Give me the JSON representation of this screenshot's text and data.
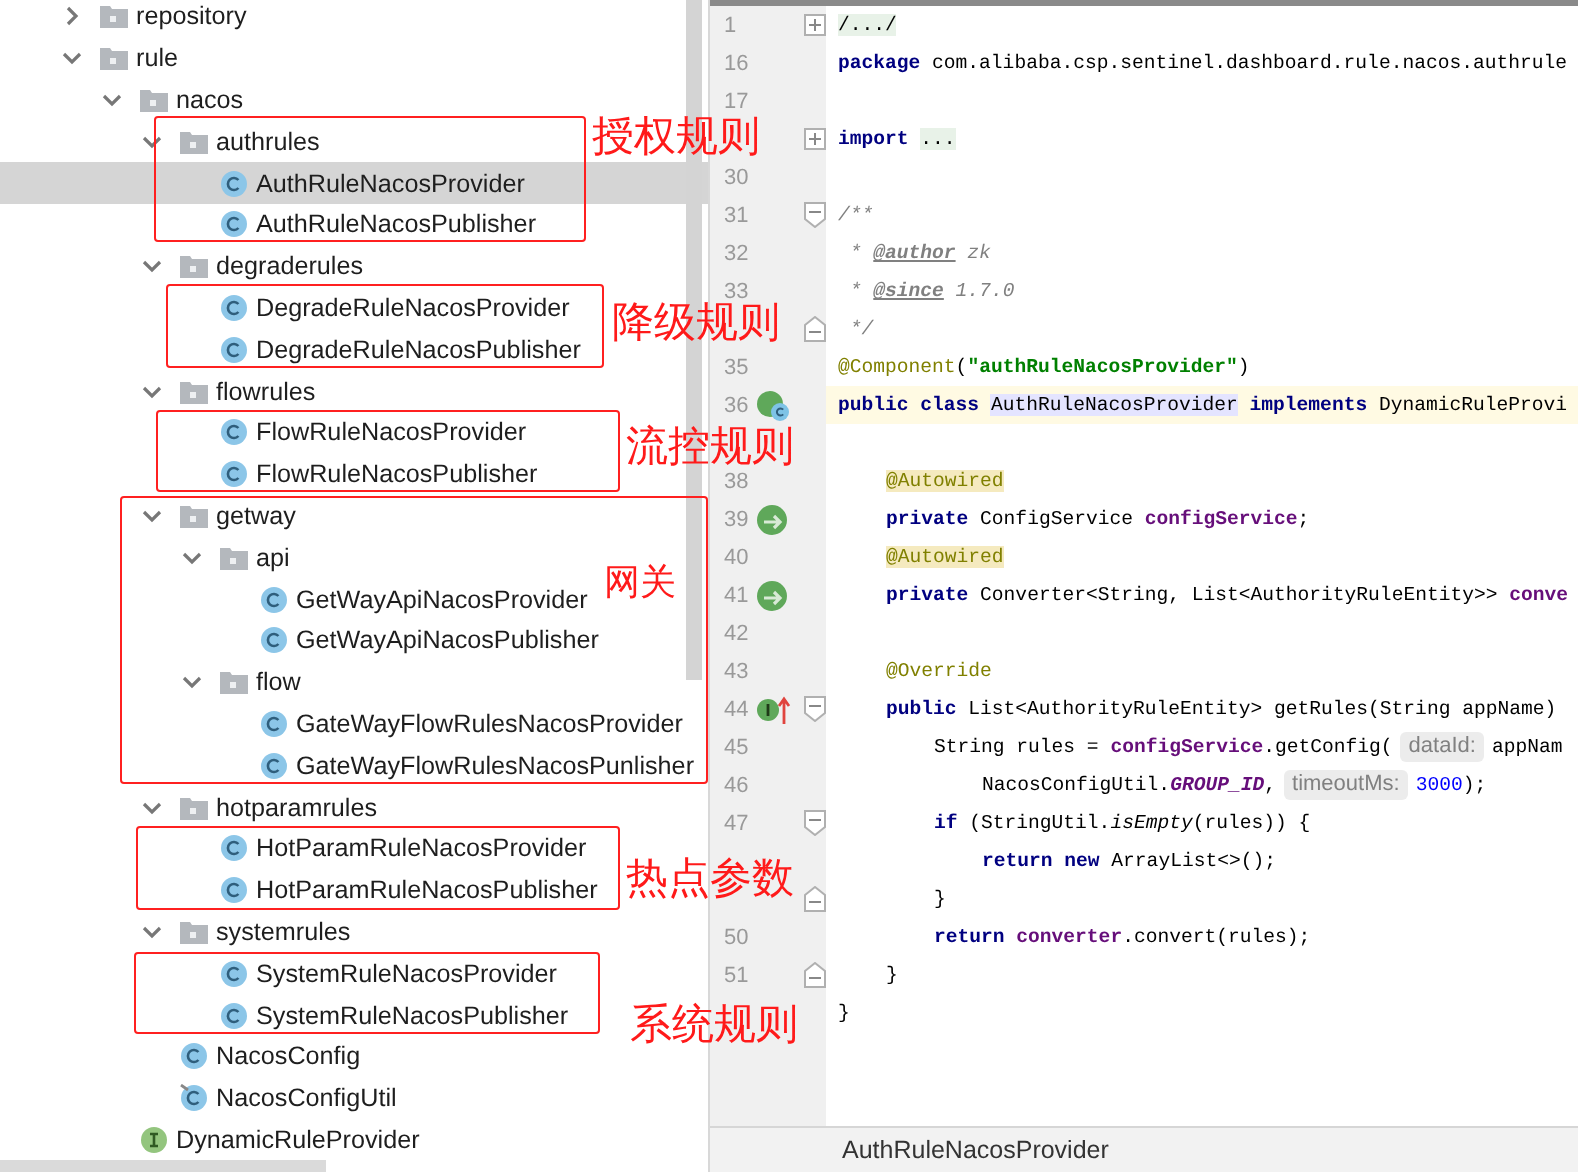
{
  "tree": [
    {
      "label": "repository",
      "kind": "folder",
      "expanded": false,
      "selected": false
    },
    {
      "label": "rule",
      "kind": "folder",
      "expanded": true,
      "selected": false,
      "children": [
        {
          "label": "nacos",
          "kind": "folder",
          "expanded": true,
          "selected": false,
          "children": [
            {
              "label": "authrules",
              "kind": "folder",
              "expanded": true,
              "selected": false,
              "children": [
                {
                  "label": "AuthRuleNacosProvider",
                  "kind": "class",
                  "selected": true
                },
                {
                  "label": "AuthRuleNacosPublisher",
                  "kind": "class",
                  "selected": false
                }
              ]
            },
            {
              "label": "degraderules",
              "kind": "folder",
              "expanded": true,
              "selected": false,
              "children": [
                {
                  "label": "DegradeRuleNacosProvider",
                  "kind": "class",
                  "selected": false
                },
                {
                  "label": "DegradeRuleNacosPublisher",
                  "kind": "class",
                  "selected": false
                }
              ]
            },
            {
              "label": "flowrules",
              "kind": "folder",
              "expanded": true,
              "selected": false,
              "children": [
                {
                  "label": "FlowRuleNacosProvider",
                  "kind": "class",
                  "selected": false
                },
                {
                  "label": "FlowRuleNacosPublisher",
                  "kind": "class",
                  "selected": false
                }
              ]
            },
            {
              "label": "getway",
              "kind": "folder",
              "expanded": true,
              "selected": false,
              "children": [
                {
                  "label": "api",
                  "kind": "folder",
                  "expanded": true,
                  "selected": false,
                  "children": [
                    {
                      "label": "GetWayApiNacosProvider",
                      "kind": "class",
                      "selected": false
                    },
                    {
                      "label": "GetWayApiNacosPublisher",
                      "kind": "class",
                      "selected": false
                    }
                  ]
                },
                {
                  "label": "flow",
                  "kind": "folder",
                  "expanded": true,
                  "selected": false,
                  "children": [
                    {
                      "label": "GateWayFlowRulesNacosProvider",
                      "kind": "class",
                      "selected": false
                    },
                    {
                      "label": "GateWayFlowRulesNacosPunlisher",
                      "kind": "class",
                      "selected": false
                    }
                  ]
                }
              ]
            },
            {
              "label": "hotparamrules",
              "kind": "folder",
              "expanded": true,
              "selected": false,
              "children": [
                {
                  "label": "HotParamRuleNacosProvider",
                  "kind": "class",
                  "selected": false
                },
                {
                  "label": "HotParamRuleNacosPublisher",
                  "kind": "class",
                  "selected": false
                }
              ]
            },
            {
              "label": "systemrules",
              "kind": "folder",
              "expanded": true,
              "selected": false,
              "children": [
                {
                  "label": "SystemRuleNacosProvider",
                  "kind": "class",
                  "selected": false
                },
                {
                  "label": "SystemRuleNacosPublisher",
                  "kind": "class",
                  "selected": false
                }
              ]
            },
            {
              "label": "NacosConfig",
              "kind": "class",
              "selected": false
            },
            {
              "label": "NacosConfigUtil",
              "kind": "marked-class",
              "selected": false
            }
          ]
        },
        {
          "label": "DynamicRuleProvider",
          "kind": "interface",
          "selected": false
        }
      ]
    }
  ],
  "annotations": [
    {
      "label": "授权规则"
    },
    {
      "label": "降级规则"
    },
    {
      "label": "流控规则"
    },
    {
      "label": "网关"
    },
    {
      "label": "热点参数"
    },
    {
      "label": "系统规则"
    }
  ],
  "code_lines": [
    {
      "number": "1",
      "kind": "top",
      "current": false,
      "fold": {
        "kind": "expand"
      },
      "segments": [
        {
          "text": "/.../",
          "kind": "folded"
        }
      ]
    },
    {
      "number": "16",
      "kind": "top",
      "current": false,
      "segments": [
        {
          "text": "package",
          "kind": "keyword"
        },
        {
          "text": " com.alibaba.csp.sentinel.dashboard.rule.nacos.authrule",
          "kind": "plain"
        }
      ]
    },
    {
      "number": "17",
      "kind": "top",
      "current": false
    },
    {
      "kind": "top",
      "current": false,
      "fold": {
        "kind": "expand"
      },
      "segments": [
        {
          "text": "import ",
          "kind": "keyword"
        },
        {
          "text": "...",
          "kind": "folded"
        }
      ]
    },
    {
      "number": "30",
      "kind": "top",
      "current": false
    },
    {
      "number": "31",
      "kind": "top",
      "current": false,
      "fold": {
        "kind": "open"
      },
      "segments": [
        {
          "text": "/**",
          "kind": "comment"
        }
      ]
    },
    {
      "number": "32",
      "kind": "top",
      "current": false,
      "segments": [
        {
          "text": " * ",
          "kind": "comment"
        },
        {
          "text": "@author",
          "kind": "doctag"
        },
        {
          "text": " zk",
          "kind": "comment"
        }
      ]
    },
    {
      "number": "33",
      "kind": "top",
      "current": false,
      "segments": [
        {
          "text": " * ",
          "kind": "comment"
        },
        {
          "text": "@since",
          "kind": "doctag"
        },
        {
          "text": " 1.7.0",
          "kind": "comment"
        }
      ]
    },
    {
      "kind": "top",
      "current": false,
      "fold": {
        "kind": "close"
      },
      "segments": [
        {
          "text": " */",
          "kind": "comment"
        }
      ]
    },
    {
      "number": "35",
      "kind": "top",
      "current": false,
      "segments": [
        {
          "text": "@Component",
          "kind": "annotation"
        },
        {
          "text": "(",
          "kind": "plain"
        },
        {
          "text": "\"authRuleNacosProvider\"",
          "kind": "string"
        },
        {
          "text": ")",
          "kind": "plain"
        }
      ]
    },
    {
      "number": "36",
      "kind": "top",
      "current": true,
      "gutter_icon": {
        "kind": "class"
      },
      "segments": [
        {
          "text": "public class ",
          "kind": "keyword"
        },
        {
          "text": "AuthRuleNacosProvider",
          "kind": "usage"
        },
        {
          "text": " implements",
          "kind": "keyword"
        },
        {
          "text": " DynamicRuleProvi",
          "kind": "plain"
        }
      ]
    },
    {
      "kind": "top",
      "current": false
    },
    {
      "number": "38",
      "kind": "member",
      "current": false,
      "segments": [
        {
          "text": "@Autowired",
          "kind": "marked-annotation"
        }
      ]
    },
    {
      "number": "39",
      "kind": "member",
      "current": false,
      "gutter_icon": {
        "kind": "bean"
      },
      "segments": [
        {
          "text": "private ",
          "kind": "keyword"
        },
        {
          "text": "ConfigService ",
          "kind": "plain"
        },
        {
          "text": "configService",
          "kind": "field"
        },
        {
          "text": ";",
          "kind": "plain"
        }
      ]
    },
    {
      "number": "40",
      "kind": "member",
      "current": false,
      "segments": [
        {
          "text": "@Autowired",
          "kind": "marked-annotation"
        }
      ]
    },
    {
      "number": "41",
      "kind": "member",
      "current": false,
      "gutter_icon": {
        "kind": "bean"
      },
      "segments": [
        {
          "text": "private ",
          "kind": "keyword"
        },
        {
          "text": "Converter<String, List<AuthorityRuleEntity>> ",
          "kind": "plain"
        },
        {
          "text": "conve",
          "kind": "field"
        }
      ]
    },
    {
      "number": "42",
      "kind": "top",
      "current": false
    },
    {
      "number": "43",
      "kind": "member",
      "current": false,
      "segments": [
        {
          "text": "@Override",
          "kind": "annotation"
        }
      ]
    },
    {
      "number": "44",
      "kind": "member",
      "current": false,
      "gutter_icon": {
        "kind": "implements"
      },
      "fold": {
        "kind": "open"
      },
      "segments": [
        {
          "text": "public ",
          "kind": "keyword"
        },
        {
          "text": "List<AuthorityRuleEntity> getRules(String appName)",
          "kind": "plain"
        }
      ]
    },
    {
      "number": "45",
      "kind": "statement",
      "current": false,
      "segments": [
        {
          "text": "String rules = ",
          "kind": "plain"
        },
        {
          "text": "configService",
          "kind": "field"
        },
        {
          "text": ".getConfig(",
          "kind": "plain"
        },
        {
          "text": "dataId:",
          "kind": "hint"
        },
        {
          "text": "appNam",
          "kind": "plain"
        }
      ]
    },
    {
      "number": "46",
      "kind": "nested",
      "current": false,
      "segments": [
        {
          "text": "NacosConfigUtil.",
          "kind": "plain"
        },
        {
          "text": "GROUP_ID",
          "kind": "static"
        },
        {
          "text": ",",
          "kind": "plain"
        },
        {
          "text": "timeoutMs:",
          "kind": "hint"
        },
        {
          "text": "3000",
          "kind": "number"
        },
        {
          "text": ");",
          "kind": "plain"
        }
      ]
    },
    {
      "number": "47",
      "kind": "statement",
      "current": false,
      "fold": {
        "kind": "open"
      },
      "segments": [
        {
          "text": "if ",
          "kind": "keyword"
        },
        {
          "text": "(StringUtil.",
          "kind": "plain"
        },
        {
          "text": "isEmpty",
          "kind": "italic"
        },
        {
          "text": "(rules)) {",
          "kind": "plain"
        }
      ]
    },
    {
      "kind": "nested",
      "current": false,
      "segments": [
        {
          "text": "return new ",
          "kind": "keyword"
        },
        {
          "text": "ArrayList<>();",
          "kind": "plain"
        }
      ]
    },
    {
      "kind": "statement",
      "current": false,
      "fold": {
        "kind": "close"
      },
      "segments": [
        {
          "text": "}",
          "kind": "plain"
        }
      ]
    },
    {
      "number": "50",
      "kind": "statement",
      "current": false,
      "segments": [
        {
          "text": "return ",
          "kind": "keyword"
        },
        {
          "text": "converter",
          "kind": "field"
        },
        {
          "text": ".convert(rules);",
          "kind": "plain"
        }
      ]
    },
    {
      "number": "51",
      "kind": "member",
      "current": false,
      "fold": {
        "kind": "close"
      },
      "segments": [
        {
          "text": "}",
          "kind": "plain"
        }
      ]
    },
    {
      "kind": "top",
      "current": false,
      "segments": [
        {
          "text": "}",
          "kind": "plain"
        }
      ]
    },
    {
      "kind": "top",
      "current": false
    }
  ],
  "breadcrumb": "AuthRuleNacosProvider"
}
